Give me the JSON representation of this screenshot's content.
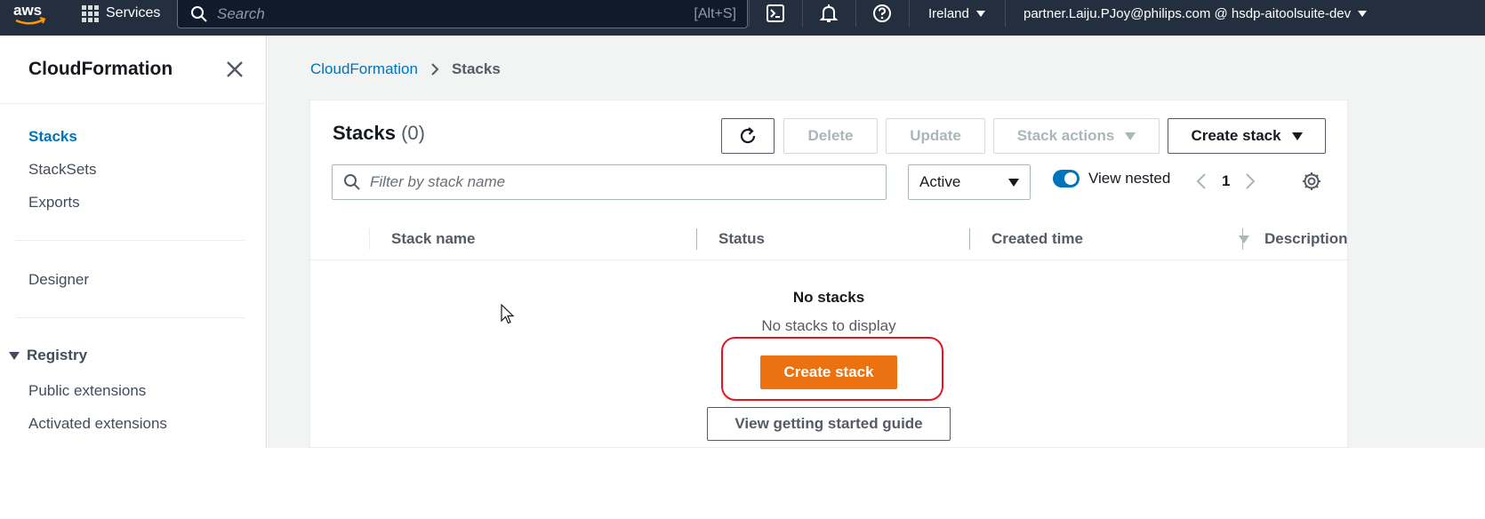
{
  "topnav": {
    "logo_text": "aws",
    "services_label": "Services",
    "search_placeholder": "Search",
    "search_shortcut": "[Alt+S]",
    "region": "Ireland",
    "account": "partner.Laiju.PJoy@philips.com @ hsdp-aitoolsuite-dev",
    "icons": [
      "cloudshell-icon",
      "notifications-icon",
      "help-icon"
    ]
  },
  "sidebar": {
    "title": "CloudFormation",
    "items": [
      {
        "label": "Stacks",
        "active": true
      },
      {
        "label": "StackSets"
      },
      {
        "label": "Exports"
      },
      {
        "label": "Designer"
      }
    ],
    "registry": {
      "label": "Registry",
      "items": [
        "Public extensions",
        "Activated extensions"
      ]
    }
  },
  "breadcrumb": {
    "root": "CloudFormation",
    "current": "Stacks"
  },
  "panel": {
    "title": "Stacks",
    "count": "(0)",
    "buttons": {
      "delete": "Delete",
      "update": "Update",
      "stack_actions": "Stack actions",
      "create_stack": "Create stack"
    },
    "filter_placeholder": "Filter by stack name",
    "status_filter": "Active",
    "view_nested_label": "View nested",
    "view_nested_on": true,
    "page": "1",
    "columns": [
      "Stack name",
      "Status",
      "Created time",
      "Description"
    ],
    "empty_title": "No stacks",
    "empty_subtitle": "No stacks to display",
    "empty_create_button": "Create stack",
    "guide_button": "View getting started guide"
  },
  "colors": {
    "nav_bg": "#232f3e",
    "link": "#0073bb",
    "primary": "#ec7211",
    "highlight": "#e8131c"
  }
}
